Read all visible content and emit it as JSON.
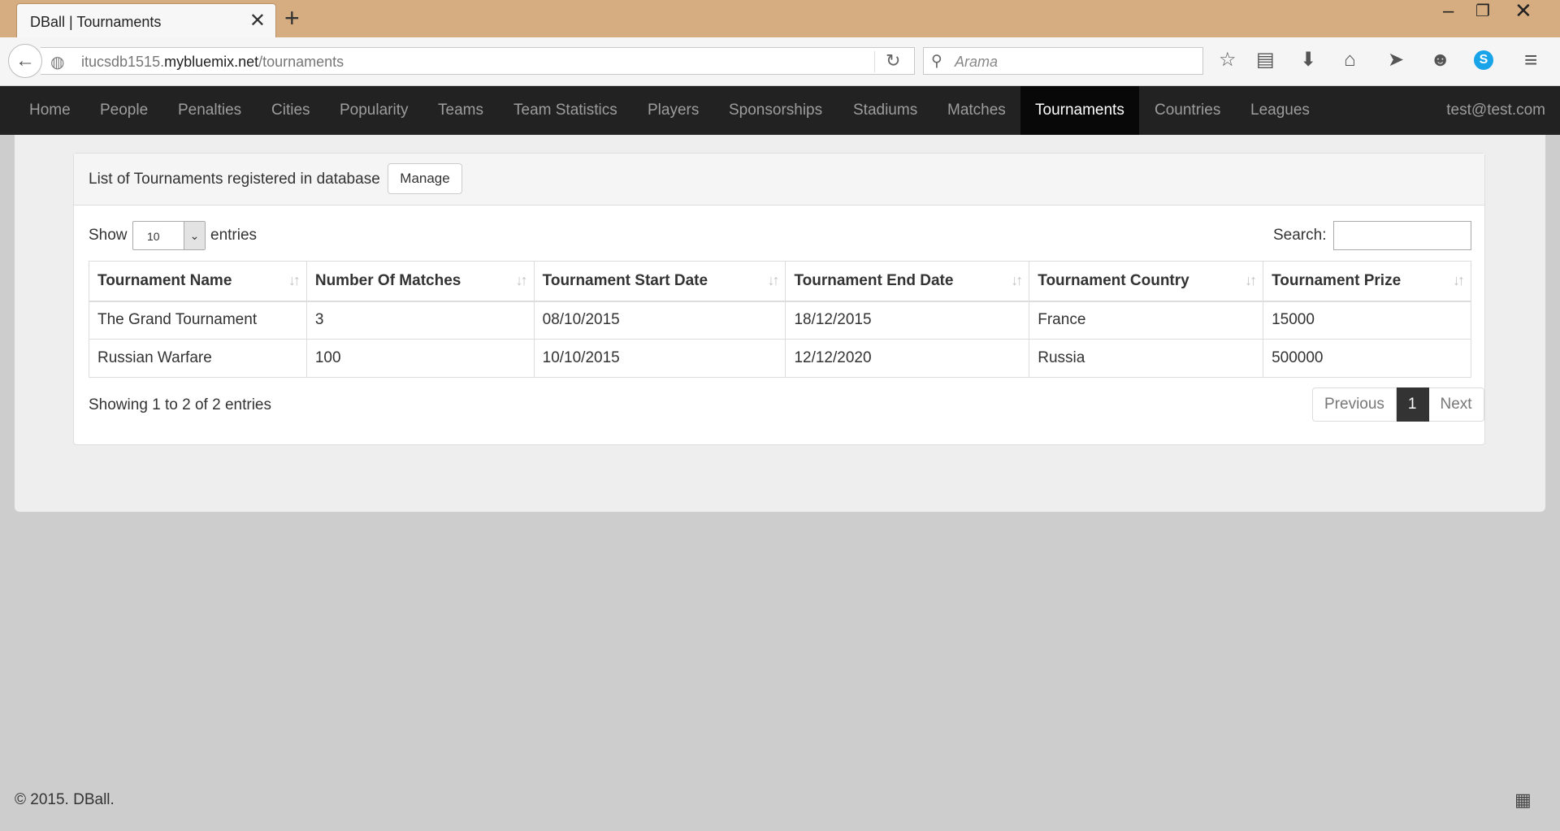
{
  "browser": {
    "tab_title": "DBall | Tournaments",
    "url_prefix": "itucsdb1515.",
    "url_host": "mybluemix.net",
    "url_path": "/tournaments",
    "search_placeholder": "Arama"
  },
  "navbar": {
    "items": [
      "Home",
      "People",
      "Penalties",
      "Cities",
      "Popularity",
      "Teams",
      "Team Statistics",
      "Players",
      "Sponsorships",
      "Stadiums",
      "Matches",
      "Tournaments",
      "Countries",
      "Leagues"
    ],
    "active": "Tournaments",
    "user": "test@test.com"
  },
  "panel": {
    "title": "List of Tournaments registered in database",
    "manage_label": "Manage"
  },
  "datatable": {
    "show_label": "Show",
    "entries_value": "10",
    "entries_label": "entries",
    "search_label": "Search:",
    "columns": [
      "Tournament Name",
      "Number Of Matches",
      "Tournament Start Date",
      "Tournament End Date",
      "Tournament Country",
      "Tournament Prize"
    ],
    "rows": [
      [
        "The Grand Tournament",
        "3",
        "08/10/2015",
        "18/12/2015",
        "France",
        "15000"
      ],
      [
        "Russian Warfare",
        "100",
        "10/10/2015",
        "12/12/2020",
        "Russia",
        "500000"
      ]
    ],
    "info": "Showing 1 to 2 of 2 entries",
    "prev_label": "Previous",
    "current_page": "1",
    "next_label": "Next"
  },
  "footer": {
    "text": "© 2015. DBall."
  }
}
